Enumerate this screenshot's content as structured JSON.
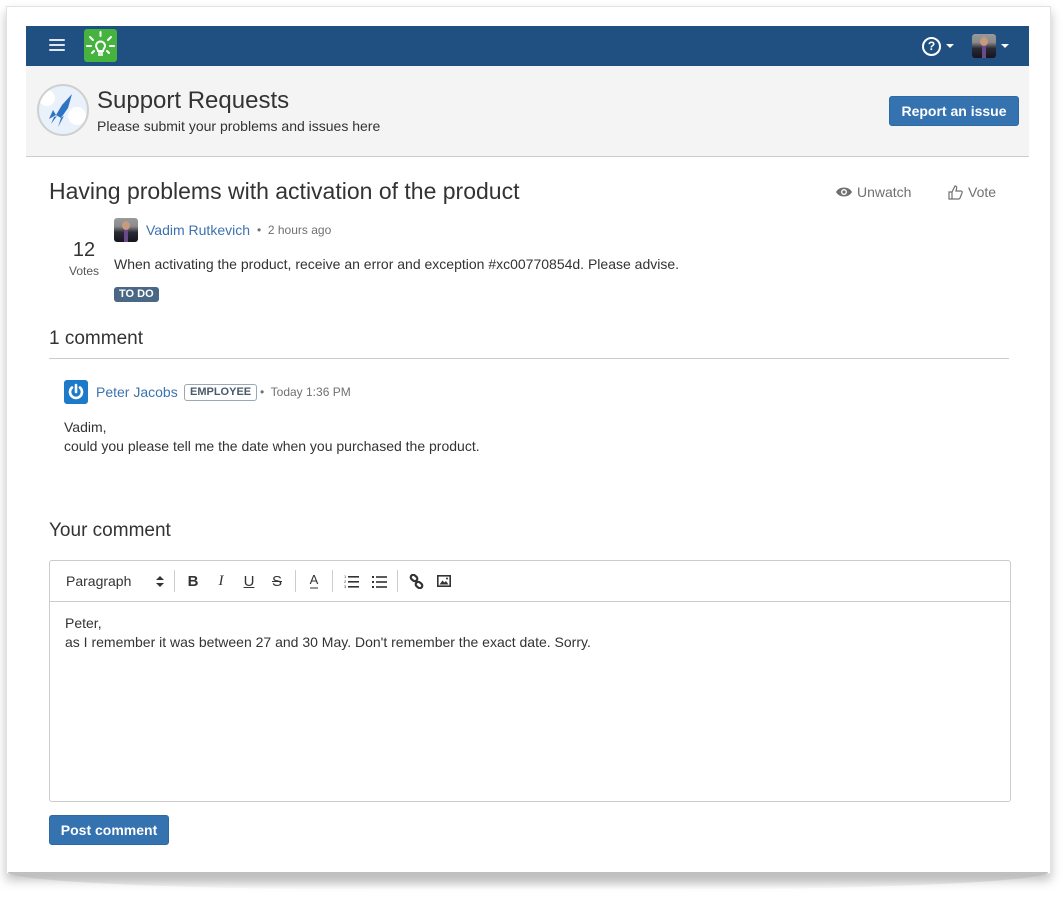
{
  "topbar": {
    "menu_icon": "hamburger-icon",
    "logo_icon": "lightbulb-icon",
    "help_icon": "question-circle-icon",
    "help_glyph": "?",
    "user_icon": "user-avatar"
  },
  "header": {
    "portal_icon": "rocket-icon",
    "title": "Support Requests",
    "subtitle": "Please submit your problems and issues here",
    "report_button": "Report an issue"
  },
  "request": {
    "title": "Having problems with activation of the product",
    "unwatch_label": "Unwatch",
    "vote_label": "Vote",
    "votes_count": "12",
    "votes_label": "Votes",
    "reporter": "Vadim Rutkevich",
    "separator": "•",
    "time": "2 hours ago",
    "description": "When activating the product, receive an error and exception #xc00770854d. Please advise.",
    "status": "TO DO"
  },
  "comments": {
    "heading": "1 comment",
    "items": [
      {
        "author": "Peter Jacobs",
        "badge": "EMPLOYEE",
        "separator": "•",
        "time": "Today 1:36 PM",
        "lines": [
          "Vadim,",
          "could you please tell me the date when you purchased the product."
        ]
      }
    ]
  },
  "composer": {
    "heading": "Your comment",
    "format_select": "Paragraph",
    "toolbar": {
      "bold": "B",
      "italic": "I",
      "underline": "U",
      "strike": "S",
      "text_color": "A"
    },
    "lines": [
      "Peter,",
      "as I remember it was between 27 and 30 May. Don't remember the exact date. Sorry."
    ],
    "post_button": "Post comment"
  },
  "colors": {
    "topbar": "#205081",
    "accent": "#3572b0",
    "link": "#3b73af",
    "logo": "#46b33e",
    "status": "#4a6785"
  }
}
